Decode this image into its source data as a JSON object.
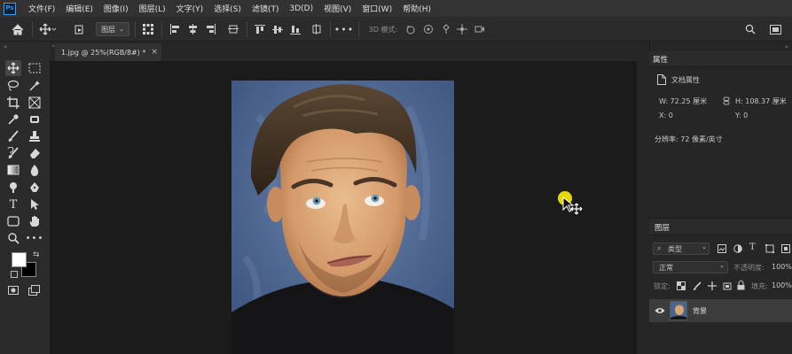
{
  "app": {
    "logo": "Ps"
  },
  "menu": [
    "文件(F)",
    "编辑(E)",
    "图像(I)",
    "图层(L)",
    "文字(Y)",
    "选择(S)",
    "滤镜(T)",
    "3D(D)",
    "视图(V)",
    "窗口(W)",
    "帮助(H)"
  ],
  "options": {
    "layer_select": "图层",
    "mode_3d": "3D 模式:",
    "icons": [
      "home-icon",
      "move-icon",
      "auto-select-icon",
      "align-icons",
      "distribute-icons",
      "more-icon",
      "3d-orbit-icons",
      "search-icon",
      "workspace-icon"
    ]
  },
  "document": {
    "tab_title": "1.jpg @ 25%(RGB/8#) *",
    "close": "×"
  },
  "tools": [
    "move-tool",
    "marquee-tool",
    "lasso-tool",
    "magic-wand-tool",
    "crop-tool",
    "frame-tool",
    "eyedropper-tool",
    "patch-tool",
    "brush-tool",
    "stamp-tool",
    "history-brush-tool",
    "eraser-tool",
    "gradient-tool",
    "blur-tool",
    "dodge-tool",
    "pen-tool",
    "type-tool",
    "path-select-tool",
    "rectangle-tool",
    "hand-tool",
    "zoom-tool",
    "more-tools"
  ],
  "properties": {
    "tab": "属性",
    "title": "文档属性",
    "w": "W:  72.25 厘米",
    "h": "H:  108.37 厘米",
    "x": "X:  0",
    "y": "Y:  0",
    "resolution": "分辨率: 72 像素/英寸"
  },
  "layers": {
    "tab": "图层",
    "filter_kind": "类型",
    "blend_mode": "正常",
    "opacity_label": "不透明度:",
    "opacity_value": "100%",
    "lock_label": "锁定:",
    "fill_label": "填充:",
    "fill_value": "100%",
    "items": [
      {
        "name": "背景",
        "visible": true
      }
    ]
  },
  "colors": {
    "accent": "#31a8ff",
    "canvas_bg": "#1b1b1c",
    "panel_bg": "#262626",
    "cursor_highlight": "#f2e100"
  }
}
